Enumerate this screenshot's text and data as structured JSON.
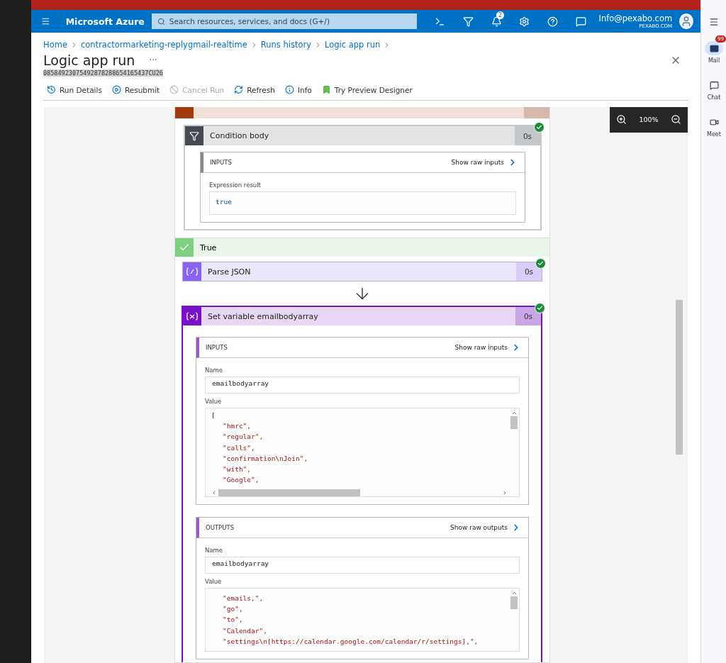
{
  "topbar": {
    "brand": "Microsoft Azure",
    "search_placeholder": "Search resources, services, and docs (G+/)",
    "notifications_count": "2",
    "account": {
      "email": "Info@pexabo.com",
      "org": "PEXABO.COM"
    }
  },
  "breadcrumb": [
    "Home",
    "contractormarketing-replygmail-realtime",
    "Runs history",
    "Logic app run"
  ],
  "page": {
    "title": "Logic app run",
    "more": "···",
    "run_id": "08584923075492878288654165437CU26"
  },
  "toolbar": [
    {
      "label": "Run Details",
      "kind": "history",
      "disabled": false
    },
    {
      "label": "Resubmit",
      "kind": "resubmit",
      "disabled": false
    },
    {
      "label": "Cancel Run",
      "kind": "cancel",
      "disabled": true
    },
    {
      "label": "Refresh",
      "kind": "refresh",
      "disabled": false
    },
    {
      "label": "Info",
      "kind": "info",
      "disabled": false
    },
    {
      "label": "Try Preview Designer",
      "kind": "preview",
      "disabled": false
    }
  ],
  "zoom": {
    "reading": "100%"
  },
  "condition": {
    "title": "Condition body",
    "duration": "0s",
    "succeeded": true,
    "section": {
      "heading": "INPUTS",
      "link": "Show raw inputs",
      "fields": [
        {
          "label": "Expression result",
          "kind": "code",
          "hscroll": false,
          "lines": [
            {
              "text": "true",
              "kind": "keyword"
            }
          ]
        }
      ]
    }
  },
  "branch": {
    "label": "True",
    "succeeded": true
  },
  "actions": [
    {
      "title": "Parse JSON",
      "kind": "parse_json",
      "duration": "0s",
      "succeeded": true
    },
    {
      "title": "Set variable emailbodyarray",
      "kind": "variable",
      "duration": "0s",
      "succeeded": true,
      "sections": [
        {
          "heading": "INPUTS",
          "link": "Show raw inputs",
          "fields": [
            {
              "label": "Name",
              "kind": "text",
              "value": "emailbodyarray"
            },
            {
              "label": "Value",
              "kind": "code",
              "hscroll": true,
              "lines": [
                {
                  "text": "[",
                  "kind": "punct"
                },
                {
                  "text": "\"hmrc\",",
                  "kind": "string"
                },
                {
                  "text": "\"regular\",",
                  "kind": "string"
                },
                {
                  "text": "\"calls\",",
                  "kind": "string"
                },
                {
                  "text": "\"confirmation\\nJoin\",",
                  "kind": "string"
                },
                {
                  "text": "\"with\",",
                  "kind": "string"
                },
                {
                  "text": "\"Google\",",
                  "kind": "string"
                }
              ]
            }
          ]
        },
        {
          "heading": "OUTPUTS",
          "link": "Show raw outputs",
          "fields": [
            {
              "label": "Name",
              "kind": "text",
              "value": "emailbodyarray"
            },
            {
              "label": "Value",
              "kind": "code",
              "hscroll": false,
              "lines": [
                {
                  "text": "\"emails,\",",
                  "kind": "string"
                },
                {
                  "text": "\"go\",",
                  "kind": "string"
                },
                {
                  "text": "\"to\",",
                  "kind": "string"
                },
                {
                  "text": "\"Calendar\",",
                  "kind": "string"
                },
                {
                  "text": "\"settings\\n[https://calendar.google.com/calendar/r/settings],\",",
                  "kind": "string"
                }
              ]
            }
          ]
        }
      ]
    }
  ],
  "right_rail": {
    "mail_badge": "99",
    "items": [
      {
        "label": "Mail",
        "kind": "mail",
        "selected": true
      },
      {
        "label": "Chat",
        "kind": "chat",
        "selected": false
      },
      {
        "label": "Meet",
        "kind": "meet",
        "selected": false
      }
    ]
  }
}
